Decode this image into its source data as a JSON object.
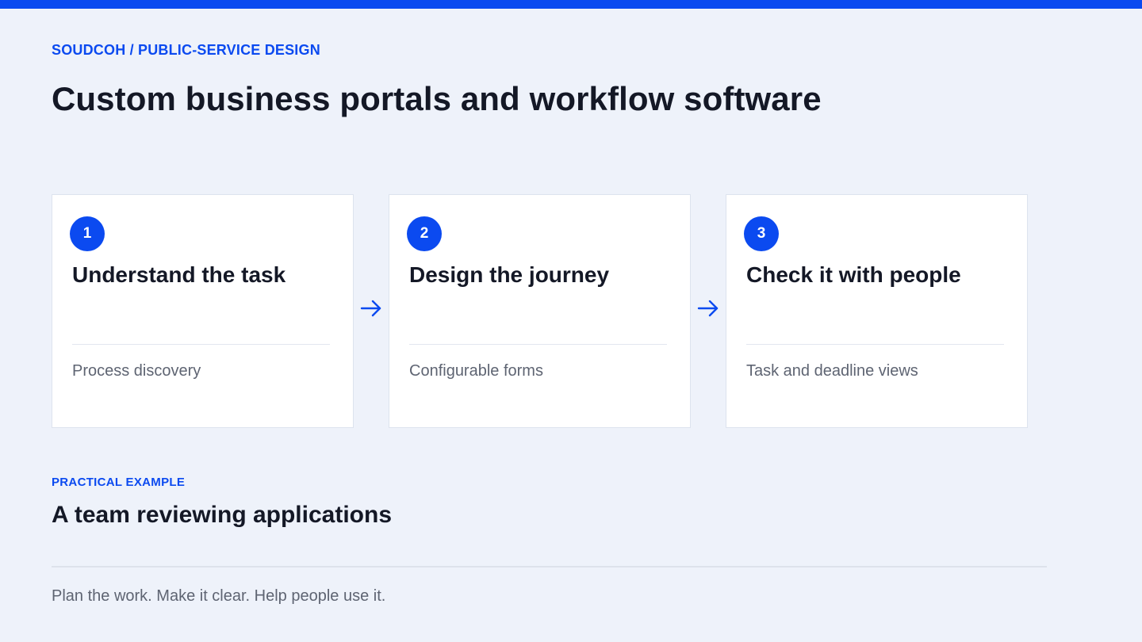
{
  "colors": {
    "accent": "#0b4af0",
    "background": "#eef2fa",
    "card": "#ffffff",
    "text": "#141826",
    "muted": "#5e6472"
  },
  "header": {
    "eyebrow": "SOUDCOH / PUBLIC-SERVICE DESIGN",
    "title": "Custom business portals and workflow software"
  },
  "steps": [
    {
      "number": "1",
      "title": "Understand the task",
      "subtitle": "Process discovery"
    },
    {
      "number": "2",
      "title": "Design the journey",
      "subtitle": "Configurable forms"
    },
    {
      "number": "3",
      "title": "Check it with people",
      "subtitle": "Task and deadline views"
    }
  ],
  "arrow_icon": "arrow-right-icon",
  "example": {
    "eyebrow": "PRACTICAL EXAMPLE",
    "title": "A team reviewing applications"
  },
  "footer": {
    "tagline": "Plan the work. Make it clear. Help people use it."
  }
}
